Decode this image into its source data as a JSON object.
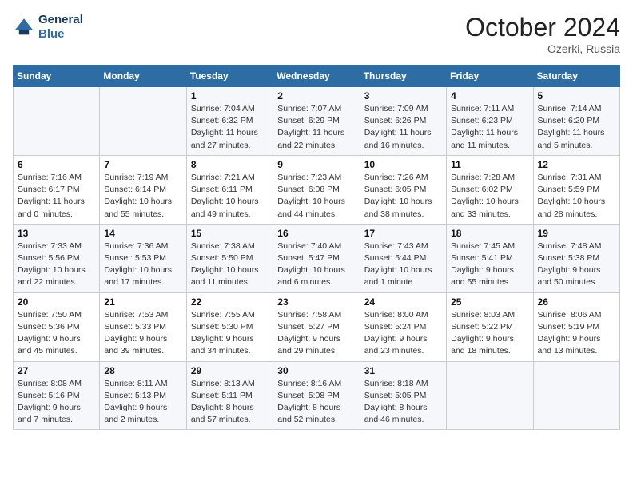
{
  "header": {
    "logo_line1": "General",
    "logo_line2": "Blue",
    "month": "October 2024",
    "location": "Ozerki, Russia"
  },
  "weekdays": [
    "Sunday",
    "Monday",
    "Tuesday",
    "Wednesday",
    "Thursday",
    "Friday",
    "Saturday"
  ],
  "weeks": [
    [
      {
        "day": "",
        "info": ""
      },
      {
        "day": "",
        "info": ""
      },
      {
        "day": "1",
        "info": "Sunrise: 7:04 AM\nSunset: 6:32 PM\nDaylight: 11 hours and 27 minutes."
      },
      {
        "day": "2",
        "info": "Sunrise: 7:07 AM\nSunset: 6:29 PM\nDaylight: 11 hours and 22 minutes."
      },
      {
        "day": "3",
        "info": "Sunrise: 7:09 AM\nSunset: 6:26 PM\nDaylight: 11 hours and 16 minutes."
      },
      {
        "day": "4",
        "info": "Sunrise: 7:11 AM\nSunset: 6:23 PM\nDaylight: 11 hours and 11 minutes."
      },
      {
        "day": "5",
        "info": "Sunrise: 7:14 AM\nSunset: 6:20 PM\nDaylight: 11 hours and 5 minutes."
      }
    ],
    [
      {
        "day": "6",
        "info": "Sunrise: 7:16 AM\nSunset: 6:17 PM\nDaylight: 11 hours and 0 minutes."
      },
      {
        "day": "7",
        "info": "Sunrise: 7:19 AM\nSunset: 6:14 PM\nDaylight: 10 hours and 55 minutes."
      },
      {
        "day": "8",
        "info": "Sunrise: 7:21 AM\nSunset: 6:11 PM\nDaylight: 10 hours and 49 minutes."
      },
      {
        "day": "9",
        "info": "Sunrise: 7:23 AM\nSunset: 6:08 PM\nDaylight: 10 hours and 44 minutes."
      },
      {
        "day": "10",
        "info": "Sunrise: 7:26 AM\nSunset: 6:05 PM\nDaylight: 10 hours and 38 minutes."
      },
      {
        "day": "11",
        "info": "Sunrise: 7:28 AM\nSunset: 6:02 PM\nDaylight: 10 hours and 33 minutes."
      },
      {
        "day": "12",
        "info": "Sunrise: 7:31 AM\nSunset: 5:59 PM\nDaylight: 10 hours and 28 minutes."
      }
    ],
    [
      {
        "day": "13",
        "info": "Sunrise: 7:33 AM\nSunset: 5:56 PM\nDaylight: 10 hours and 22 minutes."
      },
      {
        "day": "14",
        "info": "Sunrise: 7:36 AM\nSunset: 5:53 PM\nDaylight: 10 hours and 17 minutes."
      },
      {
        "day": "15",
        "info": "Sunrise: 7:38 AM\nSunset: 5:50 PM\nDaylight: 10 hours and 11 minutes."
      },
      {
        "day": "16",
        "info": "Sunrise: 7:40 AM\nSunset: 5:47 PM\nDaylight: 10 hours and 6 minutes."
      },
      {
        "day": "17",
        "info": "Sunrise: 7:43 AM\nSunset: 5:44 PM\nDaylight: 10 hours and 1 minute."
      },
      {
        "day": "18",
        "info": "Sunrise: 7:45 AM\nSunset: 5:41 PM\nDaylight: 9 hours and 55 minutes."
      },
      {
        "day": "19",
        "info": "Sunrise: 7:48 AM\nSunset: 5:38 PM\nDaylight: 9 hours and 50 minutes."
      }
    ],
    [
      {
        "day": "20",
        "info": "Sunrise: 7:50 AM\nSunset: 5:36 PM\nDaylight: 9 hours and 45 minutes."
      },
      {
        "day": "21",
        "info": "Sunrise: 7:53 AM\nSunset: 5:33 PM\nDaylight: 9 hours and 39 minutes."
      },
      {
        "day": "22",
        "info": "Sunrise: 7:55 AM\nSunset: 5:30 PM\nDaylight: 9 hours and 34 minutes."
      },
      {
        "day": "23",
        "info": "Sunrise: 7:58 AM\nSunset: 5:27 PM\nDaylight: 9 hours and 29 minutes."
      },
      {
        "day": "24",
        "info": "Sunrise: 8:00 AM\nSunset: 5:24 PM\nDaylight: 9 hours and 23 minutes."
      },
      {
        "day": "25",
        "info": "Sunrise: 8:03 AM\nSunset: 5:22 PM\nDaylight: 9 hours and 18 minutes."
      },
      {
        "day": "26",
        "info": "Sunrise: 8:06 AM\nSunset: 5:19 PM\nDaylight: 9 hours and 13 minutes."
      }
    ],
    [
      {
        "day": "27",
        "info": "Sunrise: 8:08 AM\nSunset: 5:16 PM\nDaylight: 9 hours and 7 minutes."
      },
      {
        "day": "28",
        "info": "Sunrise: 8:11 AM\nSunset: 5:13 PM\nDaylight: 9 hours and 2 minutes."
      },
      {
        "day": "29",
        "info": "Sunrise: 8:13 AM\nSunset: 5:11 PM\nDaylight: 8 hours and 57 minutes."
      },
      {
        "day": "30",
        "info": "Sunrise: 8:16 AM\nSunset: 5:08 PM\nDaylight: 8 hours and 52 minutes."
      },
      {
        "day": "31",
        "info": "Sunrise: 8:18 AM\nSunset: 5:05 PM\nDaylight: 8 hours and 46 minutes."
      },
      {
        "day": "",
        "info": ""
      },
      {
        "day": "",
        "info": ""
      }
    ]
  ]
}
